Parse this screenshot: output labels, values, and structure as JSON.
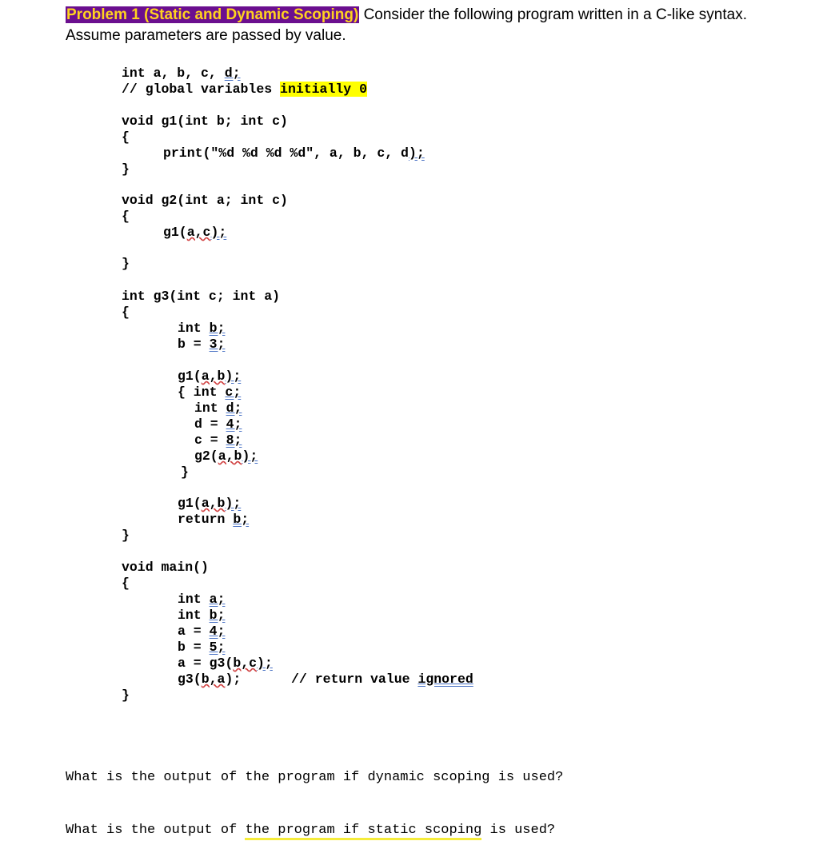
{
  "header": {
    "title": "Problem 1 (Static and Dynamic Scoping)",
    "intro_rest": " Consider the following program written in a C-like syntax.",
    "intro_line2": "Assume parameters are passed by value."
  },
  "code": {
    "globals": {
      "decl": "int a, b, c, ",
      "decl_tail": "d;",
      "comment": "// global variables ",
      "comment_hl": "initially 0"
    },
    "g1": {
      "sig": "void g1(int b; int c)",
      "open": "{",
      "body_a": "print(\"%d %d %d %d\", a, b, c, d",
      "body_b": ");",
      "close": "}"
    },
    "g2": {
      "sig": "void g2(int a; int c)",
      "open": "{",
      "body_a": "g1(",
      "body_args": "a,c",
      "body_b": ");",
      "close": "}"
    },
    "g3": {
      "sig": "int g3(int c; int a)",
      "open": "{",
      "l1": "int ",
      "l1u": "b;",
      "l2": "b = ",
      "l2u": "3;",
      "l3": "g1(",
      "l3args": "a,b",
      "l3u": ");",
      "l4": "{ int ",
      "l4u": "c;",
      "l5": "int ",
      "l5u": "d;",
      "l6": "d = ",
      "l6u": "4;",
      "l7": "c = ",
      "l7u": "8;",
      "l8": "g2(",
      "l8args": "a,b",
      "l8u": ");",
      "l9": "}",
      "l10": "g1(",
      "l10args": "a,b",
      "l10u": ");",
      "l11": "return ",
      "l11u": "b;",
      "close": "}"
    },
    "main": {
      "sig": "void main()",
      "open": "{",
      "l1": "int ",
      "l1u": "a;",
      "l2": "int ",
      "l2u": "b;",
      "l3": "a = ",
      "l3u": "4;",
      "l4": "b = ",
      "l4u": "5;",
      "l5": "a = g3(",
      "l5args": "b,c",
      "l5u": ");",
      "l6": "g3(",
      "l6args": "b,a",
      "l6b": ");",
      "l6comment": "// return value ",
      "l6comment_u": "ignored",
      "close": "}"
    }
  },
  "questions": {
    "q1": "What is the output of the program if dynamic scoping is used?",
    "q2_a": "What is the output of ",
    "q2_hl": "the program if static scoping",
    "q2_b": " is used?"
  },
  "colors": {
    "title_bg": "#6b0f8f",
    "title_fg": "#ffd21f",
    "highlight": "#ffff00"
  }
}
